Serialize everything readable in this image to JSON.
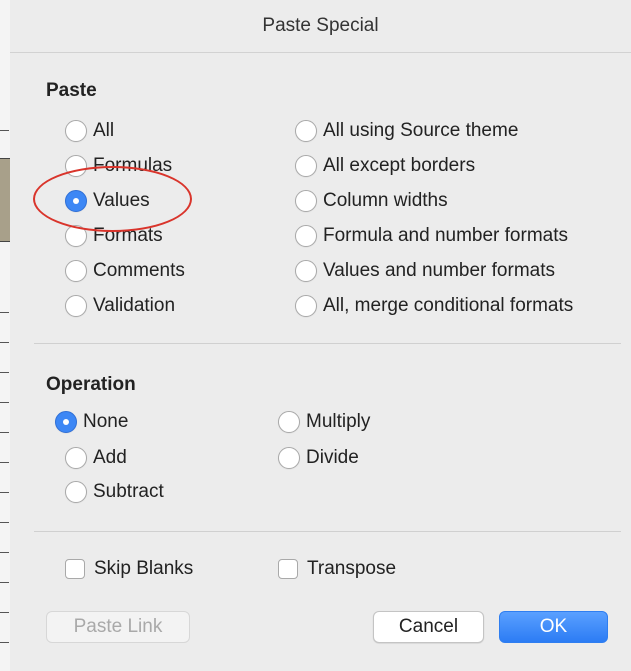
{
  "dialog": {
    "title": "Paste Special"
  },
  "paste": {
    "heading": "Paste",
    "left": [
      {
        "label": "All",
        "selected": false
      },
      {
        "label": "Formulas",
        "selected": false
      },
      {
        "label": "Values",
        "selected": true
      },
      {
        "label": "Formats",
        "selected": false
      },
      {
        "label": "Comments",
        "selected": false
      },
      {
        "label": "Validation",
        "selected": false
      }
    ],
    "right": [
      {
        "label": "All using Source theme",
        "selected": false
      },
      {
        "label": "All except borders",
        "selected": false
      },
      {
        "label": "Column widths",
        "selected": false
      },
      {
        "label": "Formula and number formats",
        "selected": false
      },
      {
        "label": "Values and number formats",
        "selected": false
      },
      {
        "label": "All, merge conditional formats",
        "selected": false
      }
    ]
  },
  "operation": {
    "heading": "Operation",
    "left": [
      {
        "label": "None",
        "selected": true
      },
      {
        "label": "Add",
        "selected": false
      },
      {
        "label": "Subtract",
        "selected": false
      }
    ],
    "right": [
      {
        "label": "Multiply",
        "selected": false
      },
      {
        "label": "Divide",
        "selected": false
      }
    ]
  },
  "options": {
    "skip_blanks": {
      "label": "Skip Blanks",
      "checked": false
    },
    "transpose": {
      "label": "Transpose",
      "checked": false
    }
  },
  "buttons": {
    "paste_link": "Paste Link",
    "cancel": "Cancel",
    "ok": "OK"
  },
  "colors": {
    "accent": "#3d87f5",
    "annotation": "#d9342b"
  }
}
